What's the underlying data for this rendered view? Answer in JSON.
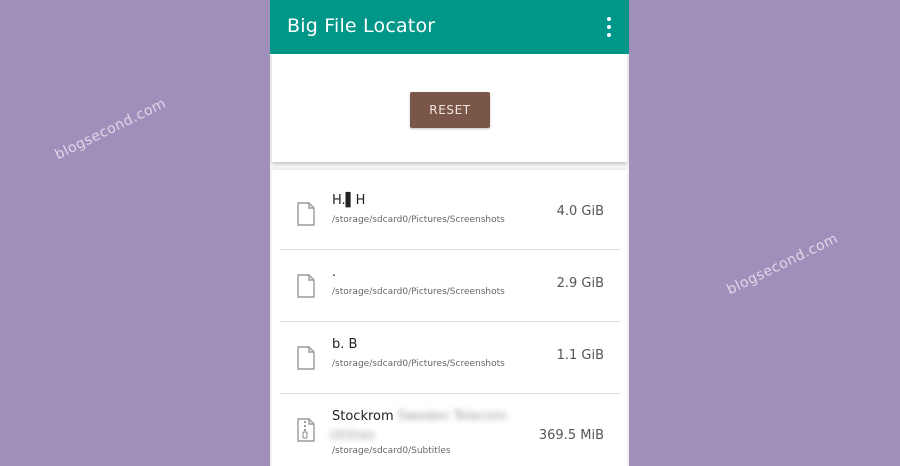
{
  "app": {
    "title": "Big File Locator",
    "accent_color": "#009688",
    "button_color": "#7a5648"
  },
  "watermarks": [
    "blogsecond.com",
    "blogsecond.com"
  ],
  "toolbar": {
    "overflow_icon": "more-vert-icon",
    "reset_label": "RESET"
  },
  "files": [
    {
      "name": "H.▌H",
      "name_blurred": "",
      "name_extra_blurred": "",
      "path": "/storage/sdcard0/Pictures/Screenshots",
      "size": "4.0 GiB",
      "icon": "file-icon"
    },
    {
      "name": ".",
      "name_blurred": "",
      "name_extra_blurred": "",
      "path": "/storage/sdcard0/Pictures/Screenshots",
      "size": "2.9 GiB",
      "icon": "file-icon"
    },
    {
      "name": "b. B",
      "name_blurred": "",
      "name_extra_blurred": "",
      "path": "/storage/sdcard0/Pictures/Screenshots",
      "size": "1.1 GiB",
      "icon": "file-icon"
    },
    {
      "name": "Stockrom",
      "name_blurred": "Sweden Telecom",
      "name_extra_blurred": "Utilities",
      "path": "/storage/sdcard0/Subtitles",
      "size": "369.5 MiB",
      "icon": "zip-file-icon"
    }
  ]
}
